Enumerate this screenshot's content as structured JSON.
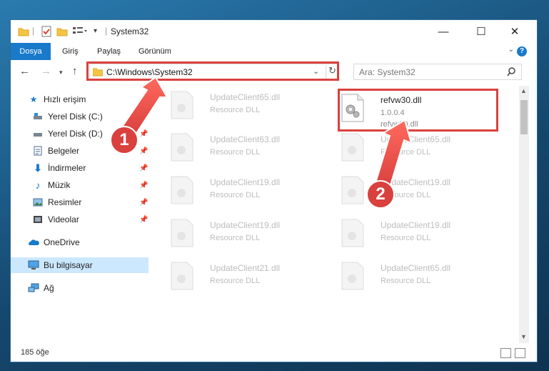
{
  "window": {
    "title": "System32",
    "minimize": "—",
    "maximize": "☐",
    "close": "✕"
  },
  "ribbon": {
    "tabs": [
      {
        "label": "Dosya",
        "active": true
      },
      {
        "label": "Giriş"
      },
      {
        "label": "Paylaş"
      },
      {
        "label": "Görünüm"
      }
    ],
    "help": "?"
  },
  "nav": {
    "address": "C:\\Windows\\System32",
    "search_placeholder": "Ara: System32"
  },
  "sidebar": {
    "items": [
      {
        "label": "Hızlı erişim",
        "icon": "star-icon"
      },
      {
        "label": "Yerel Disk (C:)",
        "icon": "drive-c-icon",
        "pinned": true
      },
      {
        "label": "Yerel Disk (D:)",
        "icon": "drive-d-icon",
        "pinned": true
      },
      {
        "label": "Belgeler",
        "icon": "documents-icon",
        "pinned": true
      },
      {
        "label": "İndirmeler",
        "icon": "downloads-icon",
        "pinned": true
      },
      {
        "label": "Müzik",
        "icon": "music-icon",
        "pinned": true
      },
      {
        "label": "Resimler",
        "icon": "pictures-icon",
        "pinned": true
      },
      {
        "label": "Videolar",
        "icon": "videos-icon",
        "pinned": true
      },
      {
        "label": "OneDrive",
        "icon": "onedrive-icon"
      },
      {
        "label": "Bu bilgisayar",
        "icon": "computer-icon",
        "selected": true
      },
      {
        "label": "Ağ",
        "icon": "network-icon"
      }
    ]
  },
  "files": {
    "highlighted": {
      "name": "refvw30.dll",
      "version": "1.0.0.4",
      "desc": "refvw30.dll"
    },
    "ghost": [
      {
        "name": "UpdateClient65.dll",
        "desc": "Resource DLL"
      },
      {
        "name": "UpdateClient63.dll",
        "desc": "Resource DLL"
      },
      {
        "name": "UpdateClient65.dll",
        "desc": "Resource DLL"
      },
      {
        "name": "UpdateClient19.dll",
        "desc": "Resource DLL"
      },
      {
        "name": "UpdateClient19.dll",
        "desc": "Resource DLL"
      },
      {
        "name": "UpdateClient19.dll",
        "desc": "Resource DLL"
      },
      {
        "name": "UpdateClient19.dll",
        "desc": "Resource DLL"
      },
      {
        "name": "UpdateClient21.dll",
        "desc": "Resource DLL"
      },
      {
        "name": "UpdateClient65.dll",
        "desc": "Resource DLL"
      }
    ]
  },
  "status": {
    "count": "185 öğe"
  },
  "annotations": {
    "step1": "1",
    "step2": "2"
  },
  "colors": {
    "accent": "#1979ca",
    "highlight": "#d9413e",
    "selected": "#cce8ff"
  }
}
